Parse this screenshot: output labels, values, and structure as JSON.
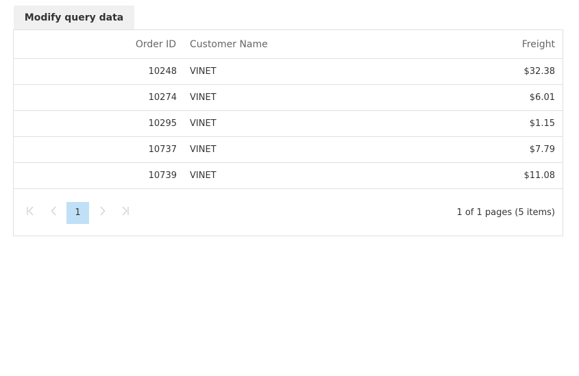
{
  "toolbar": {
    "modify_label": "Modify query data"
  },
  "grid": {
    "columns": [
      "Order ID",
      "Customer Name",
      "Freight"
    ],
    "rows": [
      {
        "order_id": "10248",
        "customer": "VINET",
        "freight": "$32.38"
      },
      {
        "order_id": "10274",
        "customer": "VINET",
        "freight": "$6.01"
      },
      {
        "order_id": "10295",
        "customer": "VINET",
        "freight": "$1.15"
      },
      {
        "order_id": "10737",
        "customer": "VINET",
        "freight": "$7.79"
      },
      {
        "order_id": "10739",
        "customer": "VINET",
        "freight": "$11.08"
      }
    ]
  },
  "pager": {
    "current_page": "1",
    "info": "1 of 1 pages (5 items)",
    "icons": [
      "first-page-icon",
      "previous-page-icon",
      "next-page-icon",
      "last-page-icon"
    ]
  },
  "colors": {
    "border": "#e0e0e0",
    "button_bg": "#f0f0f0",
    "active_page_bg": "#bfe0f6",
    "disabled_icon": "#cfcfcf"
  }
}
